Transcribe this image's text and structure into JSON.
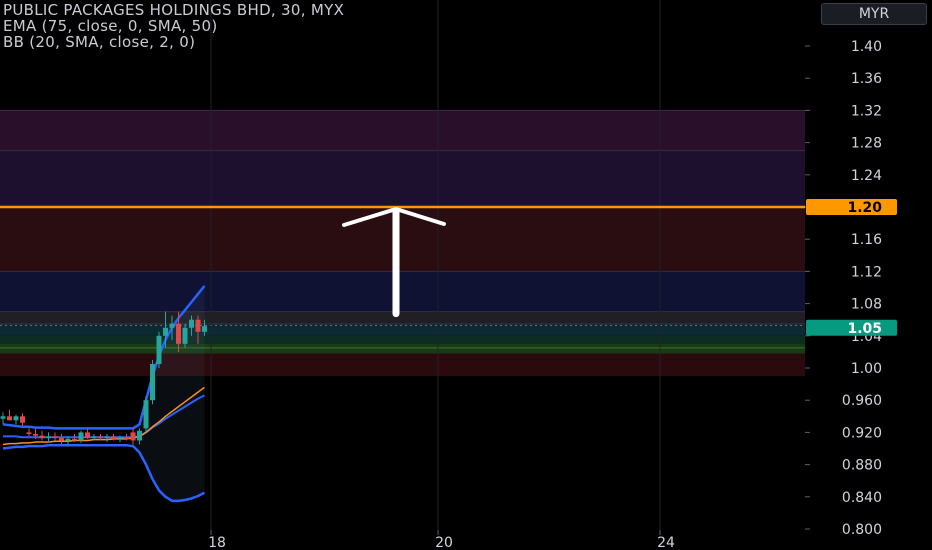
{
  "legend": {
    "title": "PUBLIC PACKAGES HOLDINGS BHD, 30, MYX",
    "indicator1": "EMA (75, close, 0, SMA, 50)",
    "indicator2": "BB (20, SMA, close, 2, 0)"
  },
  "currency_button": "MYR",
  "colors": {
    "background": "#000000",
    "candle_up": "#26a69a",
    "candle_down": "#e04848",
    "ema": "#f7931a",
    "bb_band": "#2962ff",
    "level_line": "#ff9800",
    "last_price_badge": "#089981"
  },
  "chart_data": {
    "type": "candlestick",
    "y_ticks": [
      "1.40",
      "1.36",
      "1.32",
      "1.28",
      "1.24",
      "1.20",
      "1.16",
      "1.12",
      "1.08",
      "1.04",
      "1.00",
      "0.960",
      "0.920",
      "0.880",
      "0.840",
      "0.800"
    ],
    "x_ticks": [
      "18",
      "20",
      "24"
    ],
    "ylim": [
      0.8,
      1.4
    ],
    "level_line": {
      "value": 1.2,
      "label": "1.20"
    },
    "last_price": {
      "value": 1.05,
      "label": "1.05"
    },
    "zones": [
      {
        "from": 1.27,
        "to": 1.32,
        "color": "#2a0f2a"
      },
      {
        "from": 1.2,
        "to": 1.27,
        "color": "#1d0f2e"
      },
      {
        "from": 1.12,
        "to": 1.2,
        "color": "#2a0d10"
      },
      {
        "from": 1.07,
        "to": 1.12,
        "color": "#0f1233"
      },
      {
        "from": 1.055,
        "to": 1.07,
        "color": "#1f1f24"
      },
      {
        "from": 1.04,
        "to": 1.055,
        "color": "#0d2a33"
      },
      {
        "from": 1.03,
        "to": 1.04,
        "color": "#0d2d24"
      },
      {
        "from": 1.018,
        "to": 1.03,
        "color": "#1b3a14"
      },
      {
        "from": 0.99,
        "to": 1.018,
        "color": "#2a0a0c"
      }
    ],
    "candles": [
      {
        "t": 0,
        "o": 0.937,
        "h": 0.945,
        "l": 0.93,
        "c": 0.94
      },
      {
        "t": 1,
        "o": 0.94,
        "h": 0.948,
        "l": 0.935,
        "c": 0.935
      },
      {
        "t": 2,
        "o": 0.935,
        "h": 0.942,
        "l": 0.93,
        "c": 0.94
      },
      {
        "t": 3,
        "o": 0.94,
        "h": 0.944,
        "l": 0.928,
        "c": 0.932
      },
      {
        "t": 4,
        "o": 0.92,
        "h": 0.925,
        "l": 0.915,
        "c": 0.918
      },
      {
        "t": 5,
        "o": 0.918,
        "h": 0.925,
        "l": 0.912,
        "c": 0.916
      },
      {
        "t": 6,
        "o": 0.916,
        "h": 0.922,
        "l": 0.91,
        "c": 0.913
      },
      {
        "t": 7,
        "o": 0.913,
        "h": 0.92,
        "l": 0.908,
        "c": 0.915
      },
      {
        "t": 8,
        "o": 0.915,
        "h": 0.92,
        "l": 0.91,
        "c": 0.913
      },
      {
        "t": 9,
        "o": 0.913,
        "h": 0.918,
        "l": 0.905,
        "c": 0.91
      },
      {
        "t": 10,
        "o": 0.91,
        "h": 0.915,
        "l": 0.905,
        "c": 0.912
      },
      {
        "t": 11,
        "o": 0.912,
        "h": 0.918,
        "l": 0.908,
        "c": 0.91
      },
      {
        "t": 12,
        "o": 0.91,
        "h": 0.922,
        "l": 0.907,
        "c": 0.92
      },
      {
        "t": 13,
        "o": 0.92,
        "h": 0.924,
        "l": 0.912,
        "c": 0.913
      },
      {
        "t": 14,
        "o": 0.913,
        "h": 0.918,
        "l": 0.91,
        "c": 0.915
      },
      {
        "t": 15,
        "o": 0.915,
        "h": 0.918,
        "l": 0.91,
        "c": 0.913
      },
      {
        "t": 16,
        "o": 0.913,
        "h": 0.918,
        "l": 0.908,
        "c": 0.915
      },
      {
        "t": 17,
        "o": 0.915,
        "h": 0.918,
        "l": 0.91,
        "c": 0.912
      },
      {
        "t": 18,
        "o": 0.912,
        "h": 0.916,
        "l": 0.908,
        "c": 0.914
      },
      {
        "t": 19,
        "o": 0.914,
        "h": 0.918,
        "l": 0.91,
        "c": 0.912
      },
      {
        "t": 20,
        "o": 0.92,
        "h": 0.925,
        "l": 0.905,
        "c": 0.91
      },
      {
        "t": 21,
        "o": 0.91,
        "h": 0.925,
        "l": 0.905,
        "c": 0.922
      },
      {
        "t": 22,
        "o": 0.925,
        "h": 0.965,
        "l": 0.92,
        "c": 0.96
      },
      {
        "t": 23,
        "o": 0.96,
        "h": 1.01,
        "l": 0.955,
        "c": 1.005
      },
      {
        "t": 24,
        "o": 1.005,
        "h": 1.045,
        "l": 1.0,
        "c": 1.04
      },
      {
        "t": 25,
        "o": 1.04,
        "h": 1.07,
        "l": 1.025,
        "c": 1.05
      },
      {
        "t": 26,
        "o": 1.05,
        "h": 1.065,
        "l": 1.035,
        "c": 1.055
      },
      {
        "t": 27,
        "o": 1.055,
        "h": 1.07,
        "l": 1.02,
        "c": 1.03
      },
      {
        "t": 28,
        "o": 1.03,
        "h": 1.055,
        "l": 1.025,
        "c": 1.05
      },
      {
        "t": 29,
        "o": 1.05,
        "h": 1.065,
        "l": 1.04,
        "c": 1.06
      },
      {
        "t": 30,
        "o": 1.06,
        "h": 1.065,
        "l": 1.03,
        "c": 1.045
      },
      {
        "t": 31,
        "o": 1.045,
        "h": 1.06,
        "l": 1.04,
        "c": 1.052
      }
    ],
    "ema": [
      0.905,
      0.906,
      0.906,
      0.907,
      0.907,
      0.908,
      0.908,
      0.908,
      0.909,
      0.909,
      0.909,
      0.91,
      0.91,
      0.91,
      0.911,
      0.911,
      0.911,
      0.912,
      0.912,
      0.912,
      0.913,
      0.915,
      0.92,
      0.927,
      0.933,
      0.94,
      0.946,
      0.952,
      0.958,
      0.964,
      0.97,
      0.976
    ],
    "bb_upper": [
      0.93,
      0.929,
      0.928,
      0.927,
      0.927,
      0.926,
      0.926,
      0.926,
      0.925,
      0.925,
      0.925,
      0.925,
      0.925,
      0.925,
      0.925,
      0.925,
      0.925,
      0.925,
      0.925,
      0.925,
      0.925,
      0.93,
      0.96,
      0.99,
      1.015,
      1.035,
      1.05,
      1.062,
      1.072,
      1.082,
      1.092,
      1.102
    ],
    "bb_lower": [
      0.9,
      0.901,
      0.902,
      0.902,
      0.903,
      0.903,
      0.903,
      0.904,
      0.904,
      0.904,
      0.904,
      0.904,
      0.904,
      0.904,
      0.904,
      0.904,
      0.904,
      0.904,
      0.904,
      0.904,
      0.903,
      0.895,
      0.88,
      0.862,
      0.848,
      0.84,
      0.835,
      0.835,
      0.836,
      0.838,
      0.841,
      0.845
    ],
    "bb_basis": [
      0.915,
      0.915,
      0.915,
      0.914,
      0.914,
      0.914,
      0.914,
      0.914,
      0.914,
      0.914,
      0.914,
      0.914,
      0.914,
      0.914,
      0.914,
      0.914,
      0.914,
      0.914,
      0.914,
      0.914,
      0.914,
      0.915,
      0.92,
      0.926,
      0.931,
      0.937,
      0.942,
      0.947,
      0.952,
      0.957,
      0.962,
      0.966
    ],
    "annotation": {
      "type": "arrow-up",
      "from": 1.07,
      "to": 1.2
    }
  }
}
